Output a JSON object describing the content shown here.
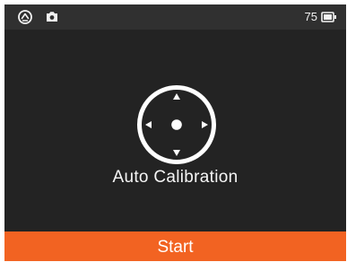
{
  "status_bar": {
    "left_icons": [
      "timer-icon",
      "camera-icon"
    ],
    "battery_level": "75",
    "battery_icon": "battery-icon"
  },
  "main": {
    "icon": "calibration-crosshair-icon",
    "title": "Auto Calibration"
  },
  "footer": {
    "start_label": "Start"
  },
  "colors": {
    "screen_background": "#232323",
    "status_bar_background": "#303030",
    "accent": "#f26322",
    "text": "#f5f5f5"
  }
}
